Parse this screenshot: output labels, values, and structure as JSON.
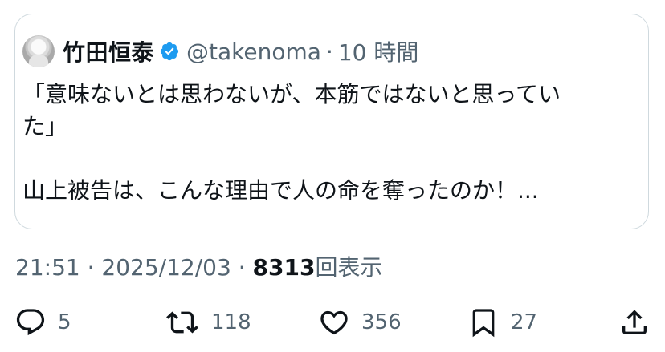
{
  "quoted_tweet": {
    "author_name": "竹田恒泰",
    "handle": "@takenoma",
    "separator": "·",
    "time_ago": "10 時間",
    "text_line1": "「意味ないとは思わないが、本筋ではないと思ってい",
    "text_line2": "た」",
    "text_line3": "山上被告は、こんな理由で人の命を奪ったのか！..."
  },
  "meta": {
    "time": "21:51",
    "dot1": "·",
    "date": "2025/12/03",
    "dot2": "·",
    "views_count": "8313",
    "views_label": "回表示"
  },
  "actions": {
    "reply_count": "5",
    "retweet_count": "118",
    "like_count": "356",
    "bookmark_count": "27"
  },
  "colors": {
    "text": "#0f1419",
    "secondary": "#536471",
    "border": "#cfd9de",
    "verified": "#1d9bf0"
  },
  "icons": [
    "verified-badge-icon",
    "reply-icon",
    "retweet-icon",
    "like-icon",
    "bookmark-icon",
    "share-icon"
  ]
}
